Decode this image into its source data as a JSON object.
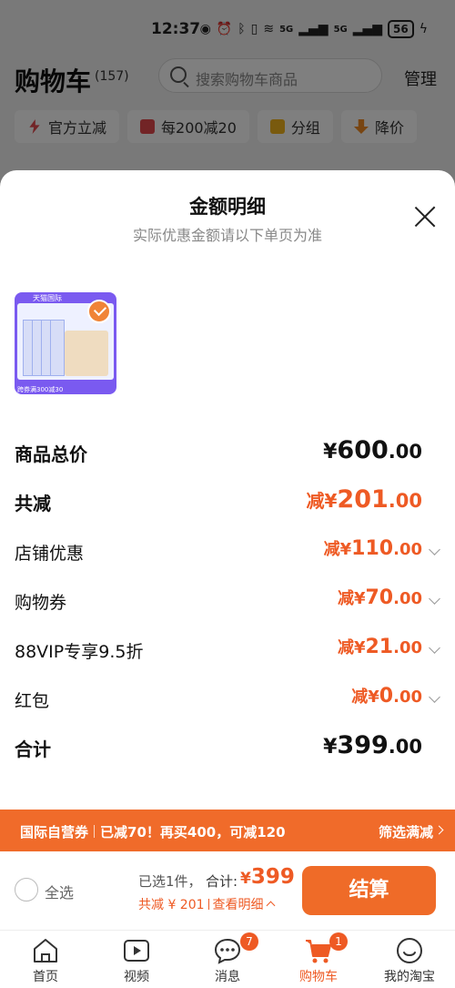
{
  "status_bar": {
    "time": "12:37",
    "battery": "56",
    "signal_1": "5G",
    "signal_2": "5G"
  },
  "cart_header": {
    "title": "购物车",
    "count": "(157)",
    "search_placeholder": "搜索购物车商品",
    "manage": "管理"
  },
  "filter_chips": [
    {
      "label": "官方立减",
      "icon": "lightning-icon",
      "color": "#e5484d"
    },
    {
      "label": "每200减20",
      "icon": "coupon-icon",
      "color": "#e5484d"
    },
    {
      "label": "分组",
      "icon": "folder-icon",
      "color": "#f2b51d"
    },
    {
      "label": "降价",
      "icon": "down-arrow-icon",
      "color": "#f08a24"
    }
  ],
  "sheet": {
    "title": "金额明细",
    "subtitle": "实际优惠金额请以下单页为准",
    "product": {
      "tmall_text": "天猫国际",
      "promo_text": "跨券满300减30",
      "selected": true
    },
    "rows": {
      "total_price": {
        "label": "商品总价",
        "currency": "¥",
        "int": "600",
        "dec": ".00"
      },
      "total_discount": {
        "label": "共减",
        "prefix": "减¥",
        "int": "201",
        "dec": ".00"
      },
      "shop_discount": {
        "label": "店铺优惠",
        "prefix": "减¥",
        "int": "110",
        "dec": ".00"
      },
      "coupon": {
        "label": "购物券",
        "prefix": "减¥",
        "int": "70",
        "dec": ".00"
      },
      "vip": {
        "label": "88VIP专享9.5折",
        "prefix": "减¥",
        "int": "21",
        "dec": ".00"
      },
      "red_packet": {
        "label": "红包",
        "prefix": "减¥",
        "int": "0",
        "dec": ".00"
      },
      "sum": {
        "label": "合计",
        "currency": "¥",
        "int": "399",
        "dec": ".00"
      }
    }
  },
  "promo_banner": {
    "tag": "国际自营券",
    "text1": "已减70！再买400，可减120",
    "action": "筛选满减"
  },
  "checkout": {
    "select_all": "全选",
    "selected_count": "已选1件，",
    "total_label": "合计:",
    "currency": "¥",
    "amount": "399",
    "discount_text": "共减 ¥ 201",
    "detail_link": "查看明细",
    "button": "结算"
  },
  "tabs": [
    {
      "label": "首页",
      "icon": "home-icon"
    },
    {
      "label": "视频",
      "icon": "video-icon"
    },
    {
      "label": "消息",
      "icon": "message-icon",
      "badge": "7"
    },
    {
      "label": "购物车",
      "icon": "cart-icon",
      "badge": "1",
      "active": true
    },
    {
      "label": "我的淘宝",
      "icon": "profile-icon"
    }
  ],
  "colors": {
    "accent": "#ee5a24",
    "button": "#ef6b28",
    "banner": "#f06b2a"
  }
}
